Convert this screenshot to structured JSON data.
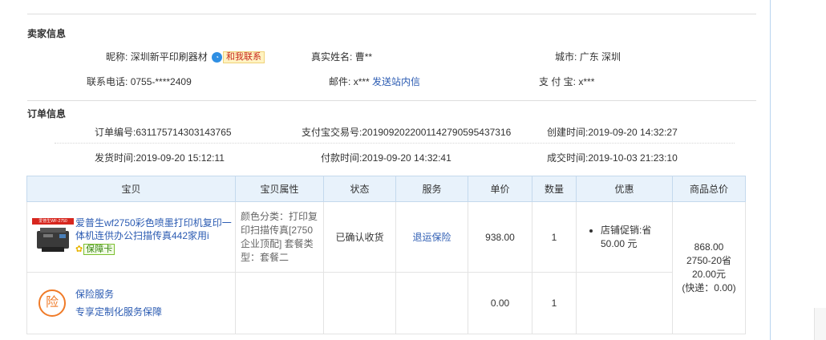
{
  "seller": {
    "title": "卖家信息",
    "nickname_label": "昵称:",
    "nickname": "深圳新平印刷器材",
    "contact_icon": "wangwang-icon",
    "contact_label": "和我联系",
    "realname_label": "真实姓名:",
    "realname": "曹**",
    "city_label": "城市:",
    "city": "广东 深圳",
    "phone_label": "联系电话:",
    "phone": "0755-****2409",
    "email_label": "邮件:",
    "email": "x***",
    "send_message_label": "发送站内信",
    "alipay_label": "支 付 宝:",
    "alipay": "x***"
  },
  "order": {
    "title": "订单信息",
    "order_no_label": "订单编号:",
    "order_no": "631175714303143765",
    "alipay_trade_label": "支付宝交易号:",
    "alipay_trade": "2019092022001142790595437316",
    "created_label": "创建时间:",
    "created": "2019-09-20 14:32:27",
    "shipped_label": "发货时间:",
    "shipped": "2019-09-20 15:12:11",
    "paid_label": "付款时间:",
    "paid": "2019-09-20 14:32:41",
    "completed_label": "成交时间:",
    "completed": "2019-10-03 21:23:10"
  },
  "table": {
    "headers": [
      "宝贝",
      "宝贝属性",
      "状态",
      "服务",
      "单价",
      "数量",
      "优惠",
      "商品总价"
    ],
    "product": {
      "thumb_text": "爱普生WF-2750",
      "name": "爱普生wf2750彩色喷墨打印机复印一体机连供办公扫描传真442家用i",
      "guarantee_label": "保障卡",
      "attributes": "颜色分类：打印复印扫描传真[2750企业顶配] 套餐类型：套餐二",
      "status": "已确认收货",
      "service": "退运保险",
      "unit_price": "938.00",
      "quantity": "1",
      "promo": "店铺促销:省50.00 元"
    },
    "insurance": {
      "icon": "险",
      "name": "保险服务",
      "desc": "专享定制化服务保障",
      "unit_price": "0.00",
      "quantity": "1"
    },
    "total": {
      "amount": "868.00",
      "discount_note": "2750-20省20.00元",
      "shipping": "(快递：0.00)"
    }
  }
}
